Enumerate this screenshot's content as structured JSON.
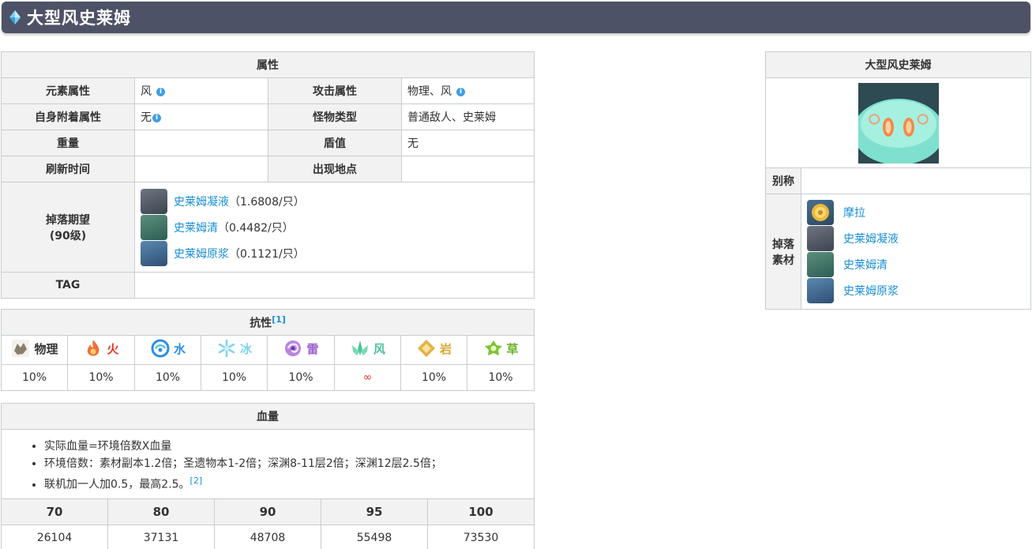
{
  "page": {
    "title": "大型风史莱姆"
  },
  "attributes": {
    "header": "属性",
    "element_label": "元素属性",
    "element_value": "风",
    "attack_label": "攻击属性",
    "attack_value": "物理、风",
    "self_attach_label": "自身附着属性",
    "self_attach_value": "无",
    "monster_type_label": "怪物类型",
    "monster_type_value": "普通敌人、史莱姆",
    "weight_label": "重量",
    "weight_value": "",
    "shield_label": "盾值",
    "shield_value": "无",
    "refresh_label": "刷新时间",
    "refresh_value": "",
    "location_label": "出现地点",
    "location_value": "",
    "drops_label_line1": "掉落期望",
    "drops_label_line2": "(90级)",
    "drops": [
      {
        "name": "史莱姆凝液",
        "rate": "（1.6808/只）",
        "icon": "slime-condensate-icon"
      },
      {
        "name": "史莱姆清",
        "rate": "（0.4482/只）",
        "icon": "slime-secretions-icon"
      },
      {
        "name": "史莱姆原浆",
        "rate": "（0.1121/只）",
        "icon": "slime-concentrate-icon"
      }
    ],
    "tag_label": "TAG",
    "tag_value": ""
  },
  "resistance": {
    "header": "抗性",
    "note_ref": "[1]",
    "elements": [
      {
        "name": "物理",
        "value": "10%",
        "color": "#333333",
        "icon": "physical-icon"
      },
      {
        "name": "火",
        "value": "10%",
        "color": "#e03b24",
        "icon": "pyro-icon"
      },
      {
        "name": "水",
        "value": "10%",
        "color": "#2b8ee8",
        "icon": "hydro-icon"
      },
      {
        "name": "冰",
        "value": "10%",
        "color": "#7fd3ee",
        "icon": "cryo-icon"
      },
      {
        "name": "雷",
        "value": "10%",
        "color": "#9b5fd1",
        "icon": "electro-icon"
      },
      {
        "name": "风",
        "value": "∞",
        "color": "#4cc49a",
        "icon": "anemo-icon"
      },
      {
        "name": "岩",
        "value": "10%",
        "color": "#d9a533",
        "icon": "geo-icon"
      },
      {
        "name": "草",
        "value": "10%",
        "color": "#6ab42a",
        "icon": "dendro-icon"
      }
    ],
    "infinity_color": "#e03b24"
  },
  "hp": {
    "header": "血量",
    "notes": [
      "实际血量=环境倍数X血量",
      "环境倍数：素材副本1.2倍；圣遗物本1-2倍；深渊8-11层2倍；深渊12层2.5倍；",
      "联机加一人加0.5，最高2.5。"
    ],
    "note_ref": "[2]",
    "levels": [
      "70",
      "80",
      "90",
      "95",
      "100"
    ],
    "values": [
      "26104",
      "37131",
      "48708",
      "55498",
      "73530"
    ]
  },
  "side_card": {
    "title": "大型风史莱姆",
    "alias_label": "别称",
    "alias_value": "",
    "drops_label_line1": "掉落",
    "drops_label_line2": "素材",
    "drops": [
      {
        "name": "摩拉",
        "icon": "mora-icon"
      },
      {
        "name": "史莱姆凝液",
        "icon": "slime-condensate-icon"
      },
      {
        "name": "史莱姆清",
        "icon": "slime-secretions-icon"
      },
      {
        "name": "史莱姆原浆",
        "icon": "slime-concentrate-icon"
      }
    ]
  }
}
